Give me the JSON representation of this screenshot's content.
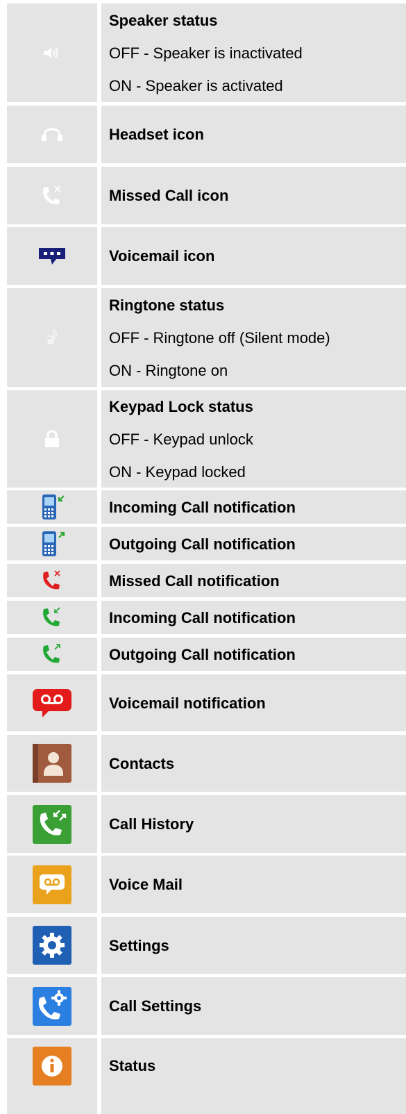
{
  "rows": [
    {
      "title": "Speaker status",
      "lines": [
        "OFF - Speaker is inactivated",
        "ON - Speaker is activated"
      ],
      "icon": "speaker-icon"
    },
    {
      "title": "Headset icon",
      "icon": "headset-icon"
    },
    {
      "title": "Missed Call icon",
      "icon": "missed-call-icon"
    },
    {
      "title": "Voicemail icon",
      "icon": "voicemail-icon"
    },
    {
      "title": "Ringtone status",
      "lines": [
        "OFF - Ringtone off (Silent mode)",
        "ON - Ringtone on"
      ],
      "icon": "ringtone-icon"
    },
    {
      "title": "Keypad Lock status",
      "lines": [
        "OFF - Keypad unlock",
        "ON - Keypad locked"
      ],
      "icon": "lock-icon"
    },
    {
      "title": "Incoming Call notification",
      "icon": "phone-incoming-icon"
    },
    {
      "title": "Outgoing Call notification",
      "icon": "phone-outgoing-icon"
    },
    {
      "title": "Missed Call notification",
      "icon": "missed-call-notification-icon"
    },
    {
      "title": "Incoming Call notification",
      "icon": "incoming-call-icon"
    },
    {
      "title": "Outgoing Call notification",
      "icon": "outgoing-call-icon"
    },
    {
      "title": "Voicemail notification",
      "icon": "voicemail-notification-icon"
    },
    {
      "title": "Contacts",
      "icon": "contacts-icon"
    },
    {
      "title": "Call History",
      "icon": "call-history-icon"
    },
    {
      "title": "Voice Mail",
      "icon": "voice-mail-icon"
    },
    {
      "title": "Settings",
      "icon": "settings-icon"
    },
    {
      "title": "Call Settings",
      "icon": "call-settings-icon"
    },
    {
      "title": "Status",
      "icon": "status-icon"
    }
  ]
}
